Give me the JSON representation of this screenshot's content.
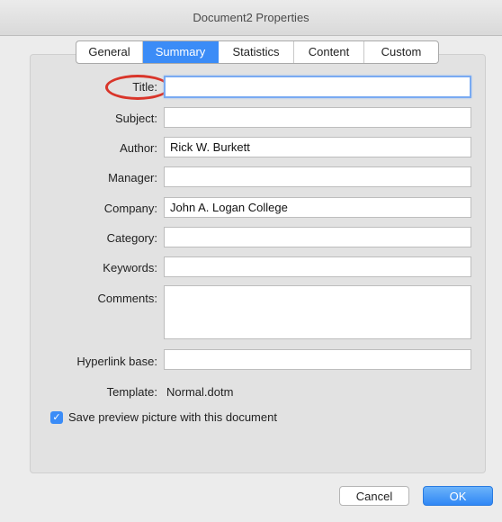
{
  "window": {
    "title": "Document2 Properties"
  },
  "tabs": [
    {
      "label": "General"
    },
    {
      "label": "Summary",
      "active": true
    },
    {
      "label": "Statistics"
    },
    {
      "label": "Content"
    },
    {
      "label": "Custom"
    }
  ],
  "fields": {
    "title": {
      "label": "Title:",
      "value": ""
    },
    "subject": {
      "label": "Subject:",
      "value": ""
    },
    "author": {
      "label": "Author:",
      "value": "Rick W. Burkett"
    },
    "manager": {
      "label": "Manager:",
      "value": ""
    },
    "company": {
      "label": "Company:",
      "value": "John A. Logan College"
    },
    "category": {
      "label": "Category:",
      "value": ""
    },
    "keywords": {
      "label": "Keywords:",
      "value": ""
    },
    "comments": {
      "label": "Comments:",
      "value": ""
    },
    "hyperlink_base": {
      "label": "Hyperlink base:",
      "value": ""
    }
  },
  "template": {
    "label": "Template:",
    "value": "Normal.dotm"
  },
  "save_preview": {
    "label": "Save preview picture with this document",
    "checked": true
  },
  "buttons": {
    "cancel": "Cancel",
    "ok": "OK"
  },
  "colors": {
    "accent": "#3b8cf7",
    "highlight_circle": "#d9352a"
  }
}
